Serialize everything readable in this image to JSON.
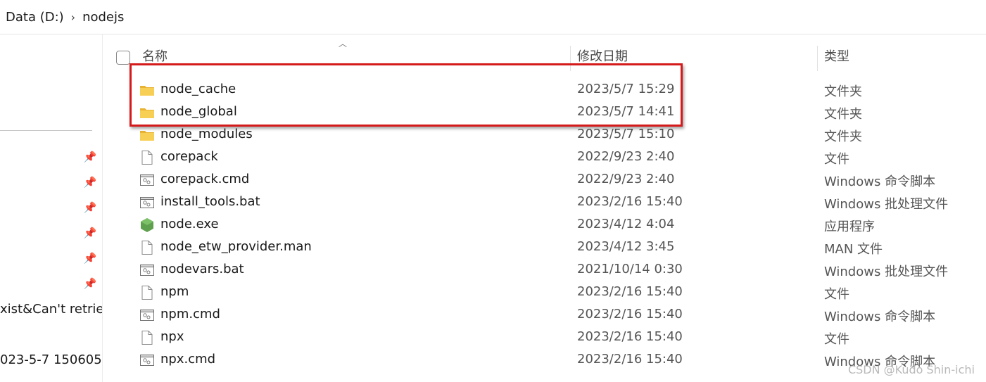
{
  "breadcrumb": {
    "items": [
      "Data (D:)",
      "nodejs"
    ],
    "separator": "›"
  },
  "nav": {
    "text_items": [
      "xist&Can't retriev",
      "023-5-7 150605"
    ],
    "pin_icon": "pin-icon"
  },
  "columns": {
    "name": "名称",
    "date": "修改日期",
    "type": "类型"
  },
  "files": [
    {
      "name": "node_cache",
      "date": "2023/5/7 15:29",
      "type": "文件夹",
      "icon": "folder"
    },
    {
      "name": "node_global",
      "date": "2023/5/7 14:41",
      "type": "文件夹",
      "icon": "folder"
    },
    {
      "name": "node_modules",
      "date": "2023/5/7 15:10",
      "type": "文件夹",
      "icon": "folder"
    },
    {
      "name": "corepack",
      "date": "2022/9/23 2:40",
      "type": "文件",
      "icon": "file"
    },
    {
      "name": "corepack.cmd",
      "date": "2022/9/23 2:40",
      "type": "Windows 命令脚本",
      "icon": "script"
    },
    {
      "name": "install_tools.bat",
      "date": "2023/2/16 15:40",
      "type": "Windows 批处理文件",
      "icon": "script"
    },
    {
      "name": "node.exe",
      "date": "2023/4/12 4:04",
      "type": "应用程序",
      "icon": "node"
    },
    {
      "name": "node_etw_provider.man",
      "date": "2023/4/12 3:45",
      "type": "MAN 文件",
      "icon": "file"
    },
    {
      "name": "nodevars.bat",
      "date": "2021/10/14 0:30",
      "type": "Windows 批处理文件",
      "icon": "script"
    },
    {
      "name": "npm",
      "date": "2023/2/16 15:40",
      "type": "文件",
      "icon": "file"
    },
    {
      "name": "npm.cmd",
      "date": "2023/2/16 15:40",
      "type": "Windows 命令脚本",
      "icon": "script"
    },
    {
      "name": "npx",
      "date": "2023/2/16 15:40",
      "type": "文件",
      "icon": "file"
    },
    {
      "name": "npx.cmd",
      "date": "2023/2/16 15:40",
      "type": "Windows 命令脚本",
      "icon": "script"
    }
  ],
  "watermark": "CSDN @Kudo Shin-ichi",
  "colors": {
    "highlight": "#d41a1a",
    "folder": "#f5c343",
    "node": "#5fa04e"
  }
}
